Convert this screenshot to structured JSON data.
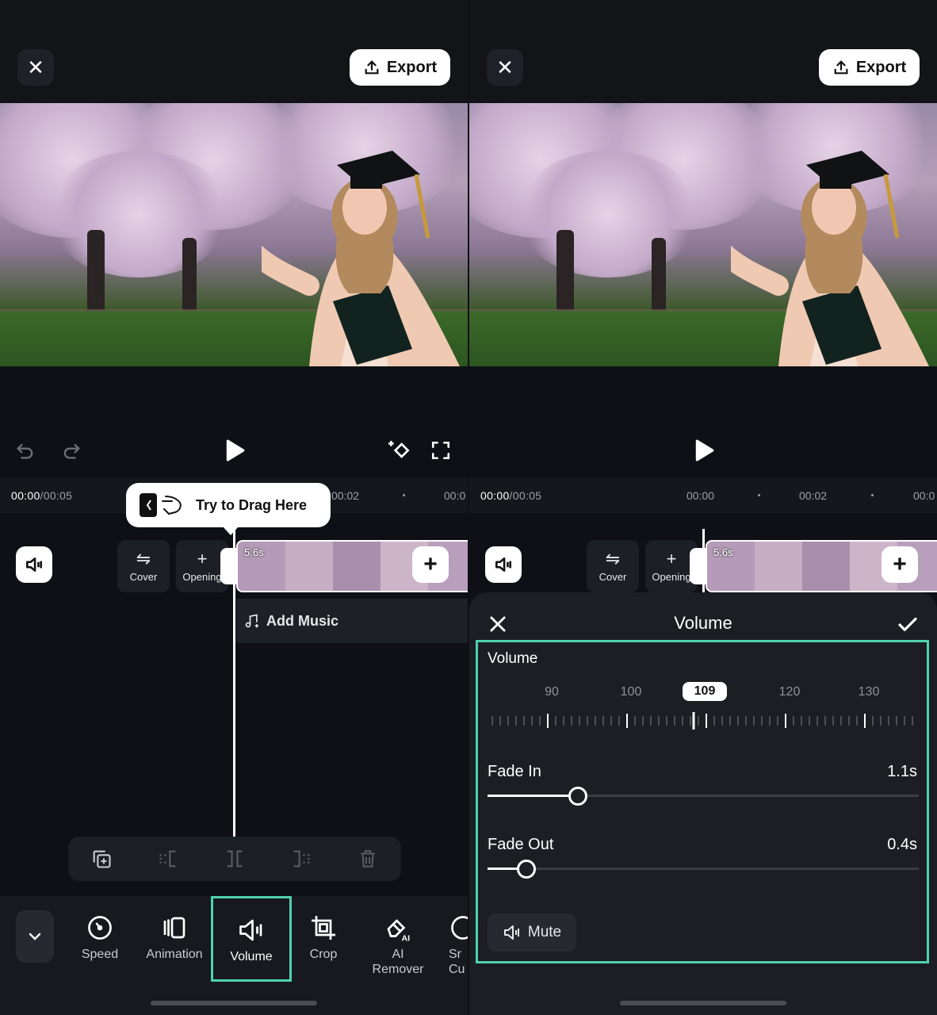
{
  "top": {
    "export_label": "Export"
  },
  "timeline": {
    "current": "00:00",
    "total": "/00:05",
    "ticks_left": [
      "00:02",
      "00:0"
    ],
    "ticks_right": [
      "00:00",
      "00:02",
      "00:0"
    ],
    "clip_length": "5.6s",
    "cover_label": "Cover",
    "opening_label": "Opening",
    "add_music_label": "Add Music",
    "tooltip": "Try to Drag Here"
  },
  "toolbar": {
    "items": [
      {
        "label": "Speed",
        "icon": "speed-icon"
      },
      {
        "label": "Animation",
        "icon": "animation-icon"
      },
      {
        "label": "Volume",
        "icon": "volume-icon",
        "active": true
      },
      {
        "label": "Crop",
        "icon": "crop-icon"
      },
      {
        "label": "AI Remover",
        "label1": "AI",
        "label2": "Remover",
        "icon": "ai-remover-icon"
      },
      {
        "label": "Sr Cu",
        "label1": "Sr",
        "label2": "Cu",
        "icon": "smart-cutout-icon"
      }
    ]
  },
  "volume_panel": {
    "title": "Volume",
    "volume_label": "Volume",
    "scale": [
      "90",
      "100",
      "120",
      "130"
    ],
    "selected_value": "109",
    "fade_in": {
      "label": "Fade In",
      "value": "1.1s",
      "level": 0.21
    },
    "fade_out": {
      "label": "Fade Out",
      "value": "0.4s",
      "level": 0.09
    },
    "mute_label": "Mute"
  },
  "colors": {
    "accent": "#4fd1b1",
    "background": "#0e1015"
  }
}
